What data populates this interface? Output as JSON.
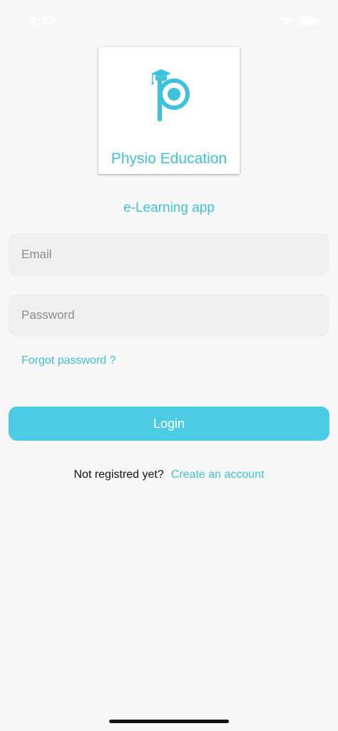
{
  "status_bar": {
    "time": "4:57",
    "icons": [
      "wifi-icon",
      "battery-icon"
    ]
  },
  "logo": {
    "name": "Physio Education",
    "icon": "graduation-cap-p-icon"
  },
  "subtitle": "e-Learning app",
  "form": {
    "email_placeholder": "Email",
    "email_value": "",
    "password_placeholder": "Password",
    "password_value": "",
    "forgot_password": "Forgot password ?",
    "login_label": "Login"
  },
  "register": {
    "prompt": "Not registred yet?",
    "link": "Create an account"
  },
  "colors": {
    "accent": "#3ec1dc",
    "button": "#4ccbe4",
    "field_background": "#efefef",
    "page_background": "#f7f7f7"
  }
}
